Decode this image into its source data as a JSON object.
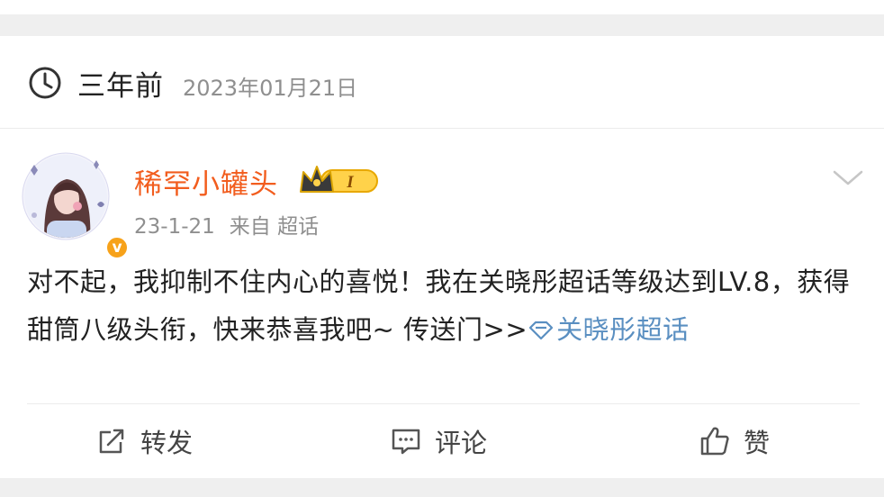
{
  "memory": {
    "ago_label": "三年前",
    "date": "2023年01月21日"
  },
  "post": {
    "username": "稀罕小罐头",
    "badge_level": "I",
    "meta_date": "23-1-21",
    "meta_source": "来自 超话",
    "text_main": "对不起，我抑制不住内心的喜悦！我在关晓彤超话等级达到LV.8，获得甜筒八级头衔，快来恭喜我吧~ 传送门>>",
    "topic_link": "关晓彤超话"
  },
  "actions": {
    "repost": "转发",
    "comment": "评论",
    "like": "赞"
  },
  "colors": {
    "username": "#f25d1e",
    "link": "#5a8fc1",
    "verified": "#f7a21a",
    "secondary_text": "#8f8f8f"
  }
}
